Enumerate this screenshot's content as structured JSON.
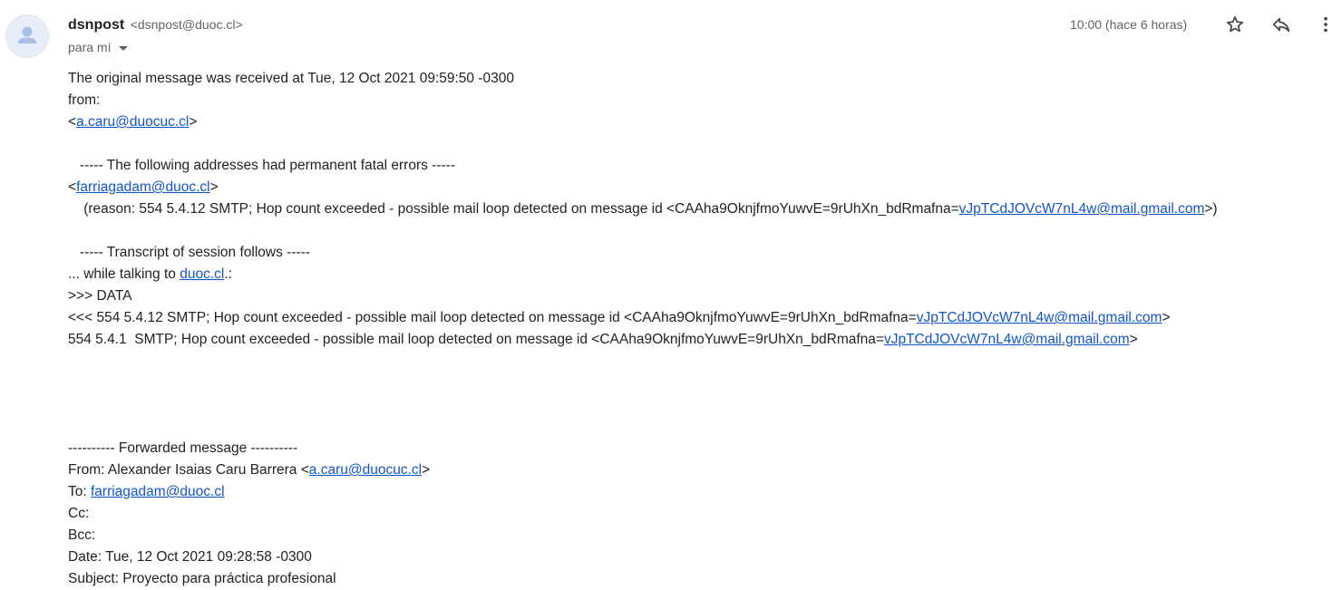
{
  "header": {
    "sender_name": "dsnpost",
    "sender_email": "<dsnpost@duoc.cl>",
    "recipient_label": "para mí",
    "timestamp": "10:00 (hace 6 horas)"
  },
  "icons": {
    "avatar": "person-icon",
    "star": "star-icon",
    "reply": "reply-icon",
    "more": "more-vert-icon"
  },
  "colors": {
    "link": "#1155cc",
    "text": "#222222",
    "secondary_text": "#5f6368",
    "avatar_bg": "#e8eef7",
    "avatar_fg": "#a9bfe3"
  },
  "body": {
    "received": "The original message was received at Tue, 12 Oct 2021 09:59:50 -0300",
    "from_label": "from:",
    "from_addr_open": "<",
    "from_addr_link": "a.caru@duocuc.cl",
    "from_addr_close": ">",
    "errors_header": "   ----- The following addresses had permanent fatal errors -----",
    "failed_open": "<",
    "failed_link": "farriagadam@duoc.cl",
    "failed_close": ">",
    "reason_prefix": "    (reason: 554 5.4.12 SMTP; Hop count exceeded - possible mail loop detected on message id <CAAha9OknjfmoYuwvE=9rUhXn_bdRmafna=",
    "reason_link": "vJpTCdJOVcW7nL4w@mail.gmail.com",
    "reason_suffix": ">)",
    "transcript_header": "   ----- Transcript of session follows -----",
    "talking_prefix": "... while talking to ",
    "talking_link": "duoc.cl",
    "talking_suffix": ".:",
    "data_line": ">>> DATA",
    "resp1_prefix": "<<< 554 5.4.12 SMTP; Hop count exceeded - possible mail loop detected on message id <CAAha9OknjfmoYuwvE=9rUhXn_bdRmafna=",
    "resp1_link": "vJpTCdJOVcW7nL4w@mail.gmail.com",
    "resp1_suffix": ">",
    "resp2_prefix": "554 5.4.1  SMTP; Hop count exceeded - possible mail loop detected on message id <CAAha9OknjfmoYuwvE=9rUhXn_bdRmafna=",
    "resp2_link": "vJpTCdJOVcW7nL4w@mail.gmail.com",
    "resp2_suffix": ">",
    "forwarded_header": "---------- Forwarded message ----------",
    "fwd_from_prefix": "From: Alexander Isaias Caru Barrera <",
    "fwd_from_link": "a.caru@duocuc.cl",
    "fwd_from_suffix": ">",
    "fwd_to_prefix": "To: ",
    "fwd_to_link": "farriagadam@duoc.cl",
    "fwd_cc": "Cc:",
    "fwd_bcc": "Bcc:",
    "fwd_date": "Date: Tue, 12 Oct 2021 09:28:58 -0300",
    "fwd_subject": "Subject: Proyecto para práctica profesional"
  }
}
